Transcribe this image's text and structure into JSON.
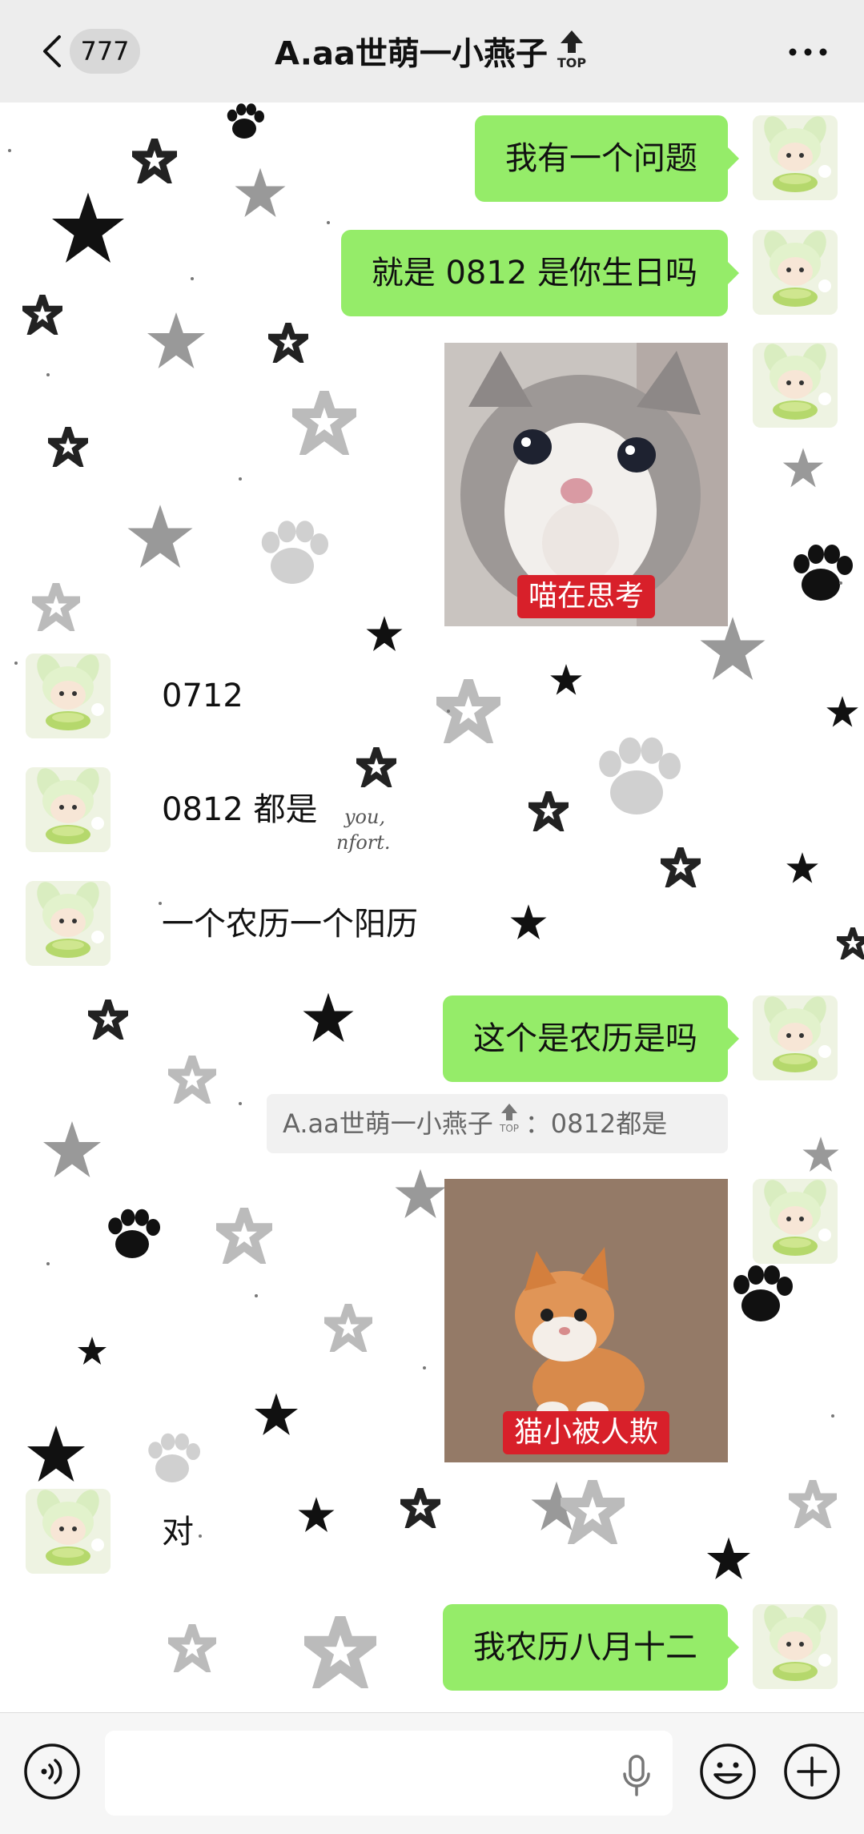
{
  "header": {
    "unread_count": "777",
    "title": "A.aa世萌一小燕子",
    "top_badge": "TOP"
  },
  "messages": [
    {
      "from": "me",
      "type": "text",
      "text": "我有一个问题"
    },
    {
      "from": "me",
      "type": "text",
      "text": "就是 0812 是你生日吗"
    },
    {
      "from": "me",
      "type": "sticker",
      "caption": "喵在思考"
    },
    {
      "from": "them",
      "type": "text",
      "text": "0712"
    },
    {
      "from": "them",
      "type": "text",
      "text": "0812 都是"
    },
    {
      "from": "them",
      "type": "text",
      "text": "一个农历一个阳历"
    },
    {
      "from": "me",
      "type": "text",
      "text": "这个是农历是吗"
    },
    {
      "from": "me",
      "type": "sticker",
      "caption": "猫小被人欺"
    },
    {
      "from": "them",
      "type": "text",
      "text": "对"
    },
    {
      "from": "me",
      "type": "text",
      "text": "我农历八月十二"
    }
  ],
  "quote": {
    "sender": "A.aa世萌一小燕子",
    "top_badge": "TOP",
    "separator": "：",
    "text": "0812都是"
  },
  "background_text": {
    "line1": "you,",
    "line2": "nfort."
  },
  "colors": {
    "header_bg": "#ededed",
    "bubble_me": "#95ec69",
    "input_bar_bg": "#f6f6f6"
  },
  "icons": {
    "back": "chevron-left-icon",
    "more": "more-dots-icon",
    "voice": "voice-mode-icon",
    "mic": "microphone-icon",
    "emoji": "emoji-icon",
    "plus": "plus-icon"
  }
}
